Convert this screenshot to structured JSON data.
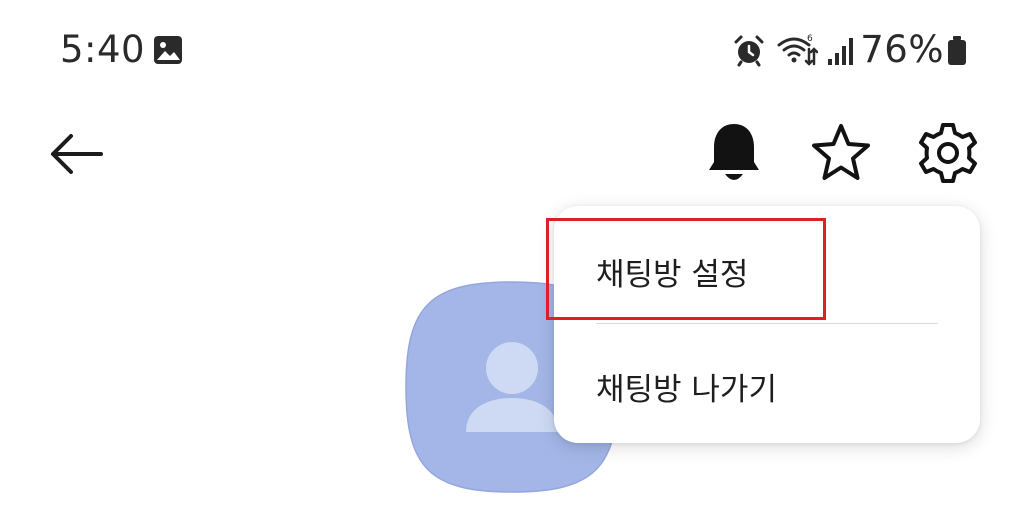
{
  "status_bar": {
    "time": "5:40",
    "battery": "76%",
    "icons": [
      "gallery-icon",
      "alarm-icon",
      "wifi-icon",
      "signal-icon",
      "battery-icon"
    ]
  },
  "toolbar": {
    "icons": [
      "back-arrow-icon",
      "bell-icon",
      "star-icon",
      "gear-icon"
    ]
  },
  "menu": {
    "items": [
      {
        "label": "채팅방 설정",
        "highlighted": true
      },
      {
        "label": "채팅방 나가기",
        "highlighted": false
      }
    ]
  },
  "avatar": {
    "icon": "person-icon",
    "color": "#a3b6e7"
  },
  "colors": {
    "highlight": "#e01e2b",
    "text": "#1e1e1e",
    "background": "#ffffff"
  }
}
